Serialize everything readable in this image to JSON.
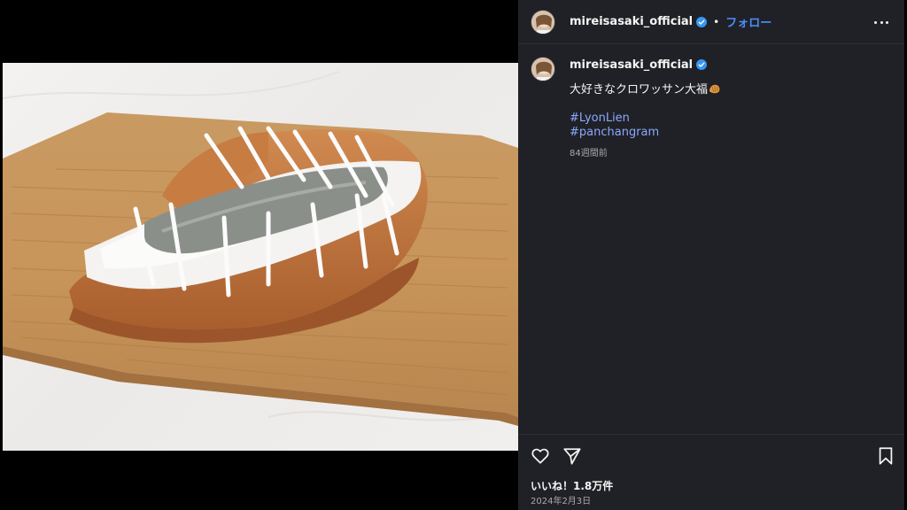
{
  "post": {
    "username": "mireisasaki_official",
    "follow_label": "フォロー",
    "separator": "•",
    "caption": "大好きなクロワッサン大福",
    "hashtags": [
      "#LyonLien",
      "#panchangram"
    ],
    "time_ago": "84週間前",
    "likes": "いいね！1.8万件",
    "date": "2024年2月3日"
  },
  "icons": {
    "verified": "verified-badge-icon",
    "more": "more-options-icon",
    "like": "heart-icon",
    "share": "send-icon",
    "save": "bookmark-icon",
    "emoji": "croissant-emoji"
  },
  "colors": {
    "panel_bg": "#202126",
    "follow": "#4c8dff",
    "hashtag": "#8aa9ff",
    "verified": "#3897f0"
  }
}
